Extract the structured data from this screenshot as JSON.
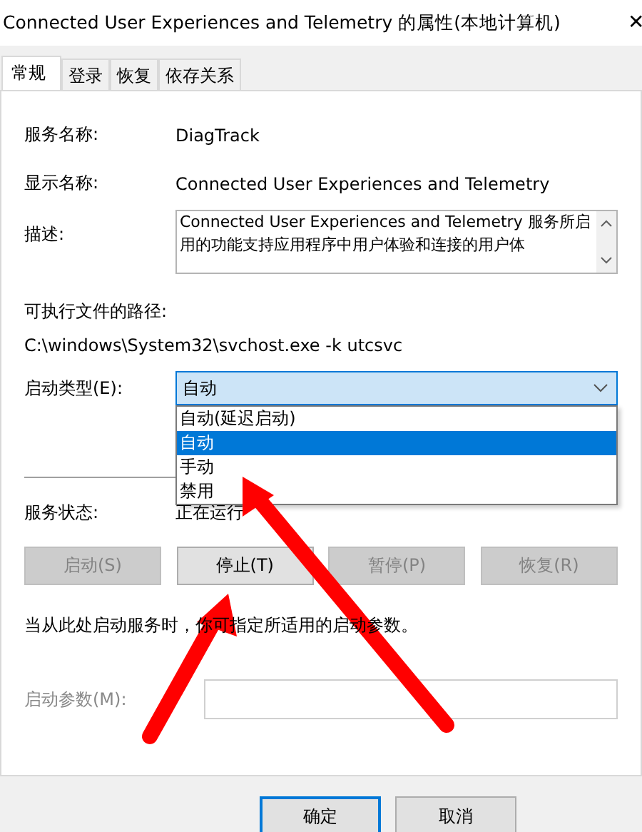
{
  "window": {
    "title": "Connected User Experiences and Telemetry 的属性(本地计算机)",
    "close": "✕"
  },
  "tabs": [
    {
      "label": "常规",
      "selected": true
    },
    {
      "label": "登录",
      "selected": false
    },
    {
      "label": "恢复",
      "selected": false
    },
    {
      "label": "依存关系",
      "selected": false
    }
  ],
  "service_name": {
    "label": "服务名称:",
    "value": "DiagTrack"
  },
  "display_name": {
    "label": "显示名称:",
    "value": "Connected User Experiences and Telemetry"
  },
  "description": {
    "label": "描述:",
    "value": "Connected User Experiences and Telemetry 服务所启用的功能支持应用程序中用户体验和连接的用户体"
  },
  "executable_path": {
    "label": "可执行文件的路径:",
    "value": "C:\\windows\\System32\\svchost.exe -k utcsvc"
  },
  "startup_type": {
    "label": "启动类型(E):",
    "value": "自动",
    "expanded": true,
    "options": [
      {
        "label": "自动(延迟启动)",
        "selected": false
      },
      {
        "label": "自动",
        "selected": true
      },
      {
        "label": "手动",
        "selected": false
      },
      {
        "label": "禁用",
        "selected": false
      }
    ]
  },
  "service_status": {
    "label": "服务状态:",
    "value": "正在运行"
  },
  "service_buttons": [
    {
      "label": "启动(S)",
      "disabled": true
    },
    {
      "label": "停止(T)",
      "disabled": false
    },
    {
      "label": "暂停(P)",
      "disabled": true
    },
    {
      "label": "恢复(R)",
      "disabled": true
    }
  ],
  "hint": "当从此处启动服务时，你可指定所适用的启动参数。",
  "start_parameters": {
    "label": "启动参数(M):",
    "disabled": true
  },
  "dialog_buttons": [
    {
      "label": "确定",
      "default": true
    },
    {
      "label": "取消",
      "default": false
    }
  ]
}
